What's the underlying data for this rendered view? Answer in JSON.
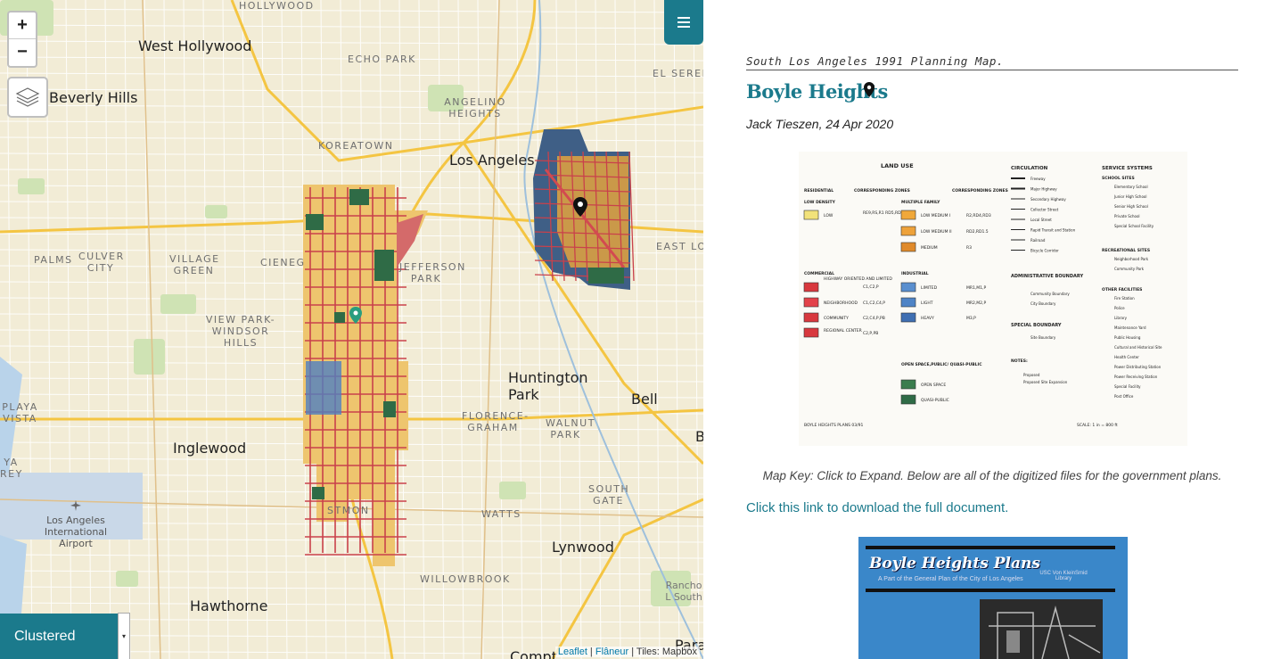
{
  "map": {
    "zoom_in": "+",
    "zoom_out": "−",
    "places": [
      {
        "id": "hollywood",
        "text": "HOLLYWOOD"
      },
      {
        "id": "west-hollywood",
        "text": "West Hollywood"
      },
      {
        "id": "beverly-hills",
        "text": "Beverly Hills"
      },
      {
        "id": "echo-park",
        "text": "ECHO PARK"
      },
      {
        "id": "el-sereno",
        "text": "EL SERENO"
      },
      {
        "id": "angelino-heights",
        "text": "ANGELINO HEIGHTS"
      },
      {
        "id": "koreatown",
        "text": "KOREATOWN"
      },
      {
        "id": "los-angeles",
        "text": "Los Angeles"
      },
      {
        "id": "east-la",
        "text": "EAST LO"
      },
      {
        "id": "palms",
        "text": "PALMS"
      },
      {
        "id": "culver-city",
        "text": "CULVER CITY"
      },
      {
        "id": "village-green",
        "text": "VILLAGE GREEN"
      },
      {
        "id": "cienega",
        "text": "CIENEG"
      },
      {
        "id": "jefferson-park",
        "text": "JEFFERSON PARK"
      },
      {
        "id": "view-park",
        "text": "VIEW PARK-WINDSOR HILLS"
      },
      {
        "id": "huntington-park",
        "text": "Huntington Park"
      },
      {
        "id": "bell",
        "text": "Bell"
      },
      {
        "id": "playa-vista",
        "text": "PLAYA VISTA"
      },
      {
        "id": "florence-graham",
        "text": "FLORENCE-GRAHAM"
      },
      {
        "id": "walnut-park",
        "text": "WALNUT PARK"
      },
      {
        "id": "inglewood",
        "text": "Inglewood"
      },
      {
        "id": "b-edge",
        "text": "B"
      },
      {
        "id": "yarey",
        "text": "YA REY"
      },
      {
        "id": "south-gate",
        "text": "SOUTH GATE"
      },
      {
        "id": "westmont",
        "text": "STMON"
      },
      {
        "id": "watts",
        "text": "WATTS"
      },
      {
        "id": "lax",
        "text": "Los Angeles International Airport"
      },
      {
        "id": "lynwood",
        "text": "Lynwood"
      },
      {
        "id": "willowbrook",
        "text": "WILLOWBROOK"
      },
      {
        "id": "rancho",
        "text": "Rancho L South"
      },
      {
        "id": "hawthorne",
        "text": "Hawthorne"
      },
      {
        "id": "paramount",
        "text": "Paramo"
      },
      {
        "id": "compton",
        "text": "Compt"
      }
    ],
    "clustered_label": "Clustered",
    "attribution": {
      "leaflet": "Leaflet",
      "flaneur": "Flâneur",
      "tiles": " | Tiles: Mapbox",
      "sep": " | "
    },
    "colors": {
      "land": "#f2ecd6",
      "park": "#cfe3b4",
      "water": "#b9d3ea",
      "road": "#ffffff",
      "freeway": "#f4c542",
      "accent": "#1b7a8c"
    }
  },
  "panel": {
    "subtitle": "South Los Angeles 1991 Planning Map.",
    "title": "Boyle Heights",
    "byline": "Jack Tieszen, 24 Apr 2020",
    "caption": "Map Key: Click to Expand. Below are all of the digitized files for the government plans.",
    "download_link": "Click this link to download the full document.",
    "cover": {
      "title": "Boyle Heights Plans",
      "subtitle": "A Part of the General Plan of the City of Los Angeles",
      "stamp": "USC Von KleinSmid Library"
    },
    "map_key": {
      "land_use": "LAND USE",
      "residential": "RESIDENTIAL",
      "low_density": "LOW DENSITY",
      "corr_zones": "CORRESPONDING ZONES",
      "low": "LOW",
      "low_zones": "RE9,RS,R1 RD5,RD6",
      "multiple_family": "MULTIPLE FAMILY",
      "low_medium_1": "LOW MEDIUM I",
      "low_medium_1_zones": "R2,RD4,RD3",
      "low_medium_2": "LOW MEDIUM II",
      "low_medium_2_zones": "RD2,RD1.5",
      "medium": "MEDIUM",
      "medium_zones": "R3",
      "commercial": "COMMERCIAL",
      "highway": "HIGHWAY ORIENTED AND LIMITED",
      "highway_zones": "C1,C2,P",
      "neighborhood": "NEIGHBORHOOD",
      "neighborhood_zones": "C1,C2,C4,P",
      "community": "COMMUNITY",
      "community_zones": "C2,C4,P,PB",
      "regional": "REGIONAL CENTER",
      "regional_zones": "C2,P,PB",
      "industrial": "INDUSTRIAL",
      "limited": "LIMITED",
      "limited_zones": "MR1,M1,P",
      "light": "LIGHT",
      "light_zones": "MR2,M2,P",
      "heavy": "HEAVY",
      "heavy_zones": "M3,P",
      "open_space_hdr": "OPEN SPACE,PUBLIC/ QUASI-PUBLIC",
      "open_space": "OPEN SPACE",
      "quasi_public": "QUASI-PUBLIC",
      "circulation": "CIRCULATION",
      "circ_items": [
        "Freeway",
        "Major Highway",
        "Secondary Highway",
        "Collector Street",
        "Local Street",
        "Rapid Transit and Station",
        "Railroad",
        "Bicycle Corridor"
      ],
      "admin_boundary": "ADMINISTRATIVE BOUNDARY",
      "community_boundary": "Community Boundary",
      "city_boundary": "City Boundary",
      "special_boundary": "SPECIAL BOUNDARY",
      "site_boundary": "Site Boundary",
      "notes": "NOTES:",
      "proposed": "Proposed",
      "proposed_site": "Proposed Site Expansion",
      "service_systems": "SERVICE SYSTEMS",
      "school_sites": "SCHOOL SITES",
      "school_items": [
        "Elementary School",
        "Junior High School",
        "Senior High School",
        "Private School",
        "Special School Facility"
      ],
      "recreational_sites": "RECREATIONAL SITES",
      "rec_items": [
        "Neighborhood Park",
        "Community Park"
      ],
      "other_facilities": "OTHER FACILITIES",
      "other_items": [
        "Fire Station",
        "Police",
        "Library",
        "Maintenance Yard",
        "Public Housing",
        "Cultural and Historical Site",
        "Health Center",
        "Power Distributing Station",
        "Power Receiving Station",
        "Special Facility",
        "Post Office"
      ],
      "footer_left": "BOYLE HEIGHTS PLANS 03/91",
      "scale": "SCALE: 1 in = 800 ft"
    }
  }
}
